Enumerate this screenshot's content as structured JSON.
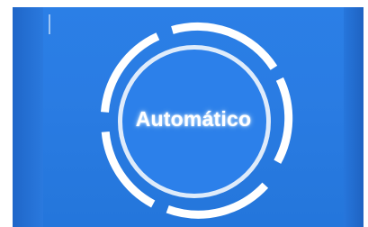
{
  "display": {
    "mode_label": "Automático",
    "background_color": "#2a7ce3",
    "ring_color": "#ffffff",
    "inner_disc_color": "#2c80ea"
  }
}
